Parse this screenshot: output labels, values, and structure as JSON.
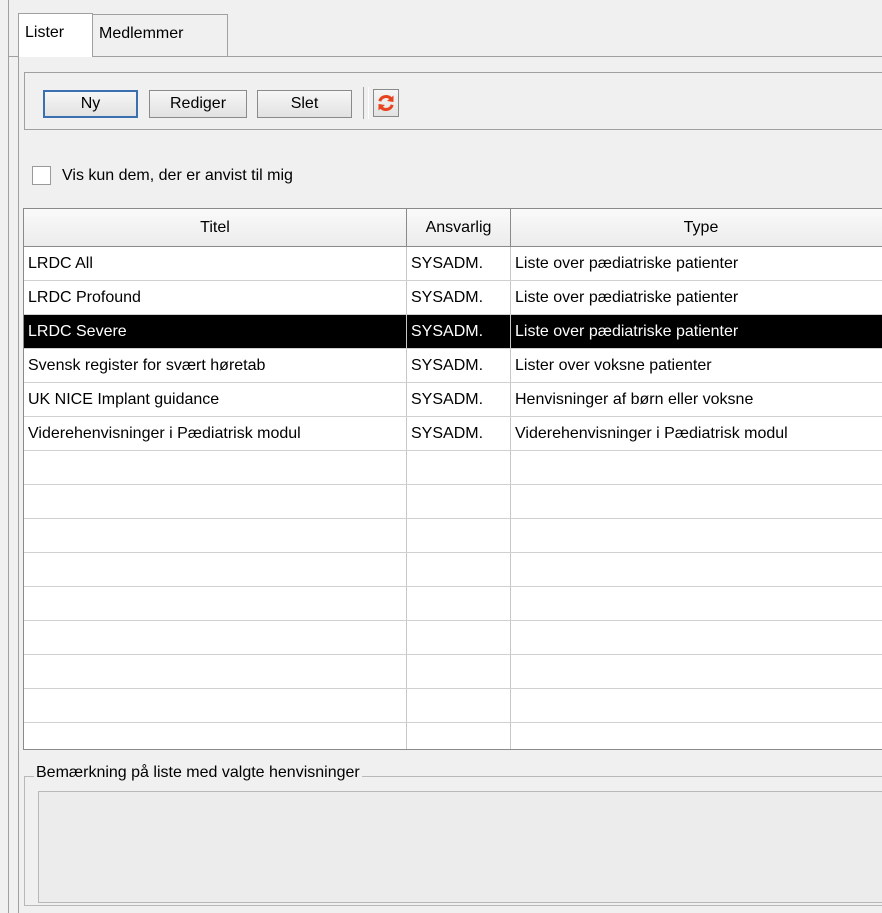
{
  "tabs": [
    {
      "label": "Lister",
      "active": true
    },
    {
      "label": "Medlemmer",
      "active": false
    }
  ],
  "toolbar": {
    "new_label": "Ny",
    "edit_label": "Rediger",
    "delete_label": "Slet",
    "refresh_icon": "refresh-icon",
    "refresh_color": "#e8421e"
  },
  "filter": {
    "checkbox_label": "Vis kun dem, der er anvist til mig",
    "checked": false
  },
  "table": {
    "columns": [
      "Titel",
      "Ansvarlig",
      "Type"
    ],
    "rows": [
      {
        "titel": "LRDC All",
        "ansvarlig": "SYSADM.",
        "type": "Liste over pædiatriske patienter"
      },
      {
        "titel": "LRDC Profound",
        "ansvarlig": "SYSADM.",
        "type": "Liste over pædiatriske patienter"
      },
      {
        "titel": "LRDC Severe",
        "ansvarlig": "SYSADM.",
        "type": "Liste over pædiatriske patienter",
        "selected": true
      },
      {
        "titel": "Svensk register for svært høretab",
        "ansvarlig": "SYSADM.",
        "type": "Lister over voksne patienter"
      },
      {
        "titel": "UK NICE Implant guidance",
        "ansvarlig": "SYSADM.",
        "type": "Henvisninger af børn eller voksne"
      },
      {
        "titel": "Viderehenvisninger i Pædiatrisk modul",
        "ansvarlig": "SYSADM.",
        "type": "Viderehenvisninger i Pædiatrisk modul"
      }
    ],
    "selected_color": "#000000"
  },
  "remark": {
    "legend": "Bemærkning på liste med valgte henvisninger",
    "text": ""
  }
}
